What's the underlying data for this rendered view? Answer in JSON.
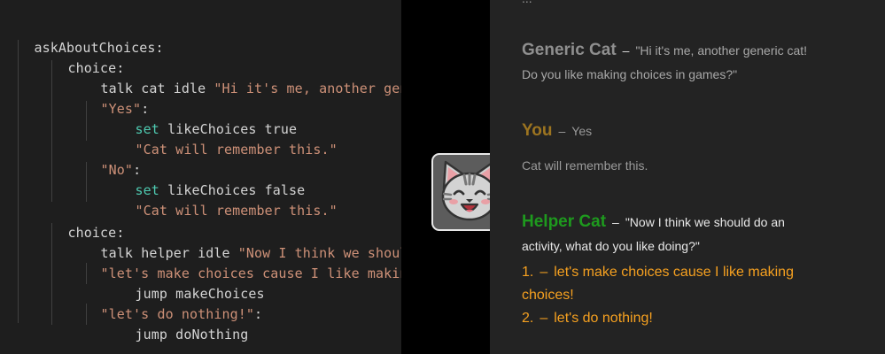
{
  "code": {
    "label": "askAboutChoices:",
    "choice_kw_1": "choice:",
    "talk_1_kw": "talk",
    "talk_1_ident": " cat idle ",
    "talk_1_text": "\"Hi it's me, another gener",
    "opt_yes": "\"Yes\"",
    "opt_yes_colon": ":",
    "set_1_kw": "set",
    "set_1_rest": " likeChoices true",
    "remember_1": "\"Cat will remember this.\"",
    "opt_no": "\"No\"",
    "opt_no_colon": ":",
    "set_2_kw": "set",
    "set_2_rest": " likeChoices false",
    "remember_2": "\"Cat will remember this.\"",
    "choice_kw_2": "choice:",
    "talk_2_kw": "talk",
    "talk_2_ident": " helper idle ",
    "talk_2_text": "\"Now I think we should",
    "opt_make": "\"let's make choices cause I like making",
    "jump_1": "jump makeChoices",
    "opt_nothing": "\"let's do nothing!\"",
    "opt_nothing_colon": ":",
    "jump_2": "jump doNothing"
  },
  "avatar": {
    "icon": "smiling-cat-face-icon"
  },
  "preview": {
    "top_partial": "...",
    "generic_cat": {
      "name": "Generic Cat",
      "dash": "–",
      "line1": "\"Hi it's me, another generic cat!",
      "line2": "Do you like making choices in games?\""
    },
    "you": {
      "name": "You",
      "dash": "–",
      "reply": "Yes"
    },
    "narration": "Cat will remember this.",
    "helper_cat": {
      "name": "Helper Cat",
      "dash": "–",
      "line1": "\"Now I think we should do an",
      "line2": "activity, what do you like doing?\""
    },
    "choices": [
      {
        "num": "1.",
        "dash": "–",
        "line1": "let's make choices cause I like making",
        "line2": "choices!"
      },
      {
        "num": "2.",
        "dash": "–",
        "line1": "let's do nothing!"
      }
    ]
  },
  "colors": {
    "generic_cat_name": "#8f8f8f",
    "you_name": "#9c7420",
    "helper_cat_name": "#1e9a1e",
    "choice_text": "#f5a020",
    "dialogue_text": "#e8e8e8",
    "muted_text": "#9a9a9a"
  }
}
